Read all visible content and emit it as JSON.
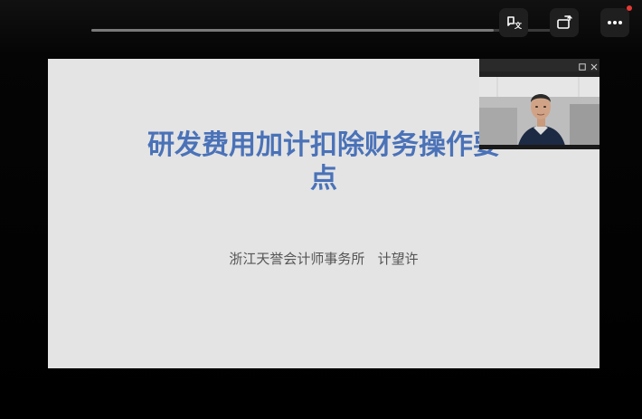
{
  "playback": {
    "progress_fraction": 0.87
  },
  "controls": [
    {
      "name": "caption-translate-button",
      "icon": "caption-translate-icon"
    },
    {
      "name": "rotate-button",
      "icon": "rotate-icon"
    },
    {
      "name": "more-button",
      "icon": "more-dots-icon"
    }
  ],
  "notification": {
    "color": "#e53935"
  },
  "slide": {
    "title_line1": "研发费用加计扣除财务操作要",
    "title_line2": "点",
    "subtitle": "浙江天誉会计师事务所   计望许",
    "title_color": "#4a72b8",
    "background_color": "#e4e4e4"
  },
  "video_window": {
    "restore_icon": "restore-window-icon",
    "close_icon": "close-icon"
  }
}
